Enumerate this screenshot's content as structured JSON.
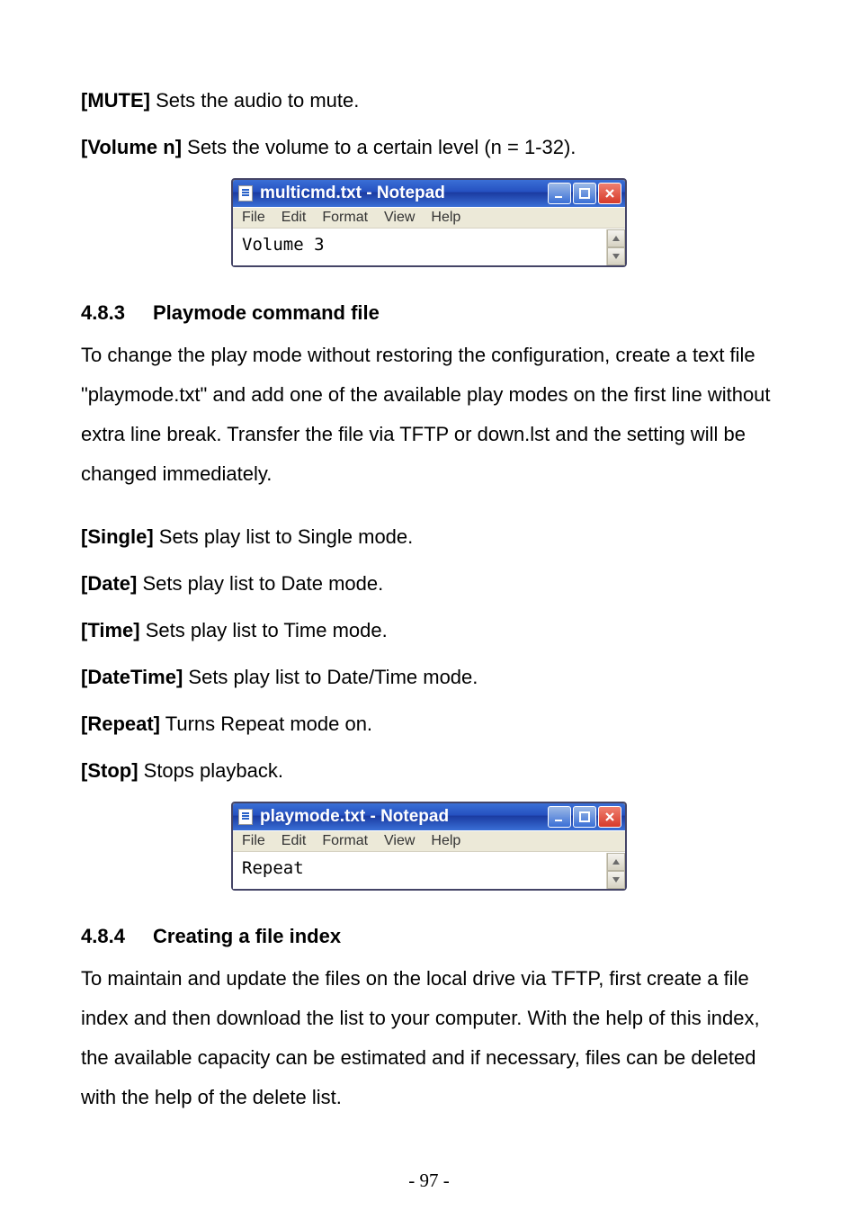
{
  "para1": {
    "bold": "[MUTE]",
    "rest": " Sets the audio to mute."
  },
  "para2": {
    "bold": "[Volume n]",
    "rest": " Sets the volume to a certain level (n = 1-32)."
  },
  "notepad1": {
    "title": "multicmd.txt - Notepad",
    "menu": {
      "file": "File",
      "edit": "Edit",
      "format": "Format",
      "view": "View",
      "help": "Help"
    },
    "content": "Volume 3"
  },
  "sec483": {
    "num": "4.8.3",
    "title": "Playmode command file"
  },
  "para3": "To change the play mode without restoring the configuration, create a text file \"playmode.txt\" and add one of the available play modes on the first line without extra line break. Transfer the file via TFTP or down.lst and the setting will be changed immediately.",
  "list": [
    {
      "bold": "[Single]",
      "rest": " Sets play list to Single mode."
    },
    {
      "bold": "[Date]",
      "rest": " Sets play list to Date mode."
    },
    {
      "bold": "[Time]",
      "rest": " Sets play list to Time mode."
    },
    {
      "bold": "[DateTime]",
      "rest": " Sets play list to Date/Time mode."
    },
    {
      "bold": "[Repeat]",
      "rest": " Turns Repeat mode on."
    },
    {
      "bold": "[Stop]",
      "rest": " Stops playback."
    }
  ],
  "notepad2": {
    "title": "playmode.txt - Notepad",
    "menu": {
      "file": "File",
      "edit": "Edit",
      "format": "Format",
      "view": "View",
      "help": "Help"
    },
    "content": "Repeat"
  },
  "sec484": {
    "num": "4.8.4",
    "title": "Creating a file index"
  },
  "para4": "To maintain and update the files on the local drive via TFTP, first create a file index and then download the list to your computer. With the help of this index, the available capacity can be estimated and if necessary, files can be deleted with the help of the delete list.",
  "pagenum": "- 97 -"
}
